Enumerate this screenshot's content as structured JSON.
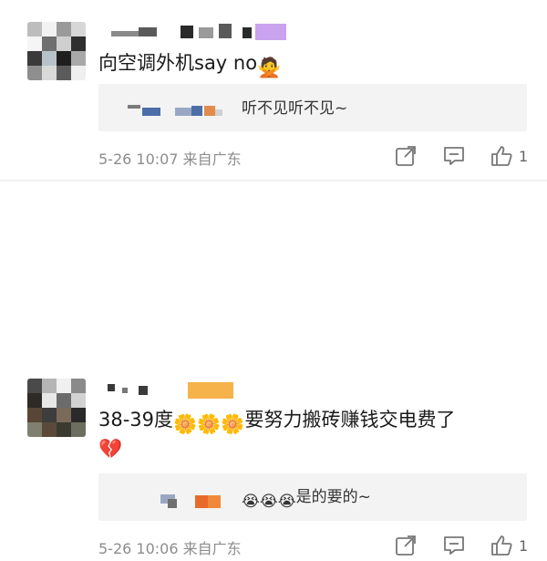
{
  "comments": [
    {
      "text": "向空调外机say no",
      "text_emoji": "🙅",
      "reply": "听不见听不见~",
      "time": "5-26 10:07",
      "location": "来自广东",
      "likes": "1"
    },
    {
      "text": "38-39度",
      "text_tail": "要努力搬砖赚钱交电费了",
      "text_emoji": "🌼🌼🌼",
      "line2_emoji": "💔",
      "reply": "是的要的~",
      "reply_emoji": "😭😭😭",
      "time": "5-26 10:06",
      "location": "来自广东",
      "likes": "1"
    }
  ],
  "icons": {
    "share": "share-icon",
    "comment": "comment-icon",
    "like": "thumbs-up-icon"
  },
  "colors": {
    "meta_gray": "#8c8c8c",
    "reply_bg": "#f3f3f3",
    "name_blob_purple": "#c9a2f0",
    "name_blob_orange": "#f6b34a"
  }
}
